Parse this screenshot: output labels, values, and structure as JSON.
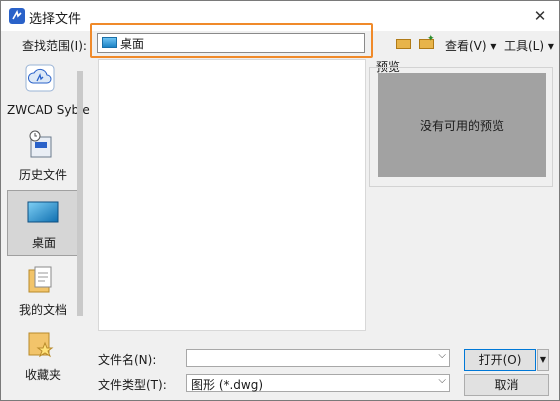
{
  "window": {
    "title": "选择文件",
    "close_glyph": "✕"
  },
  "lookin": {
    "label": "查找范围(I):",
    "value": "桌面"
  },
  "toolbar": {
    "view_label": "查看(V)",
    "tools_label": "工具(L)",
    "menu_arrow": "▾"
  },
  "places": [
    {
      "label": "ZWCAD Syble"
    },
    {
      "label": "历史文件"
    },
    {
      "label": "桌面"
    },
    {
      "label": "我的文档"
    },
    {
      "label": "收藏夹"
    }
  ],
  "preview": {
    "label": "预览",
    "empty_text": "没有可用的预览"
  },
  "filename": {
    "label": "文件名(N):",
    "value": ""
  },
  "filetype": {
    "label": "文件类型(T):",
    "value": "图形 (*.dwg)"
  },
  "buttons": {
    "open": "打开(O)",
    "open_arrow": "▼",
    "cancel": "取消"
  },
  "colors": {
    "accent": "#2a62c9",
    "highlight": "#f08a2a",
    "preview_bg": "#a2a2a2"
  },
  "icons": [
    "zwcad-app-icon",
    "folder-icon",
    "up-folder-icon",
    "new-folder-icon",
    "cloud-icon",
    "history-icon",
    "desktop-icon",
    "documents-icon",
    "favorites-icon"
  ]
}
